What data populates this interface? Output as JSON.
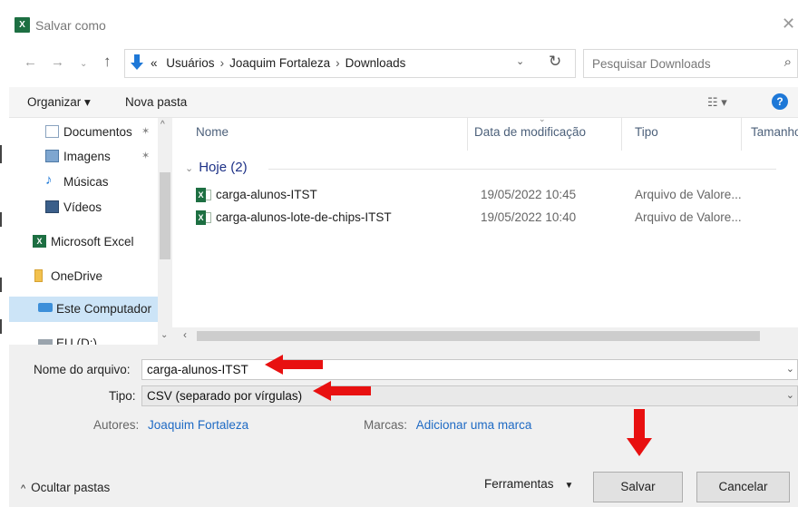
{
  "window": {
    "title": "Salvar como",
    "app_icon_text": "X"
  },
  "address": {
    "crumbs": [
      "«",
      "Usuários",
      "Joaquim Fortaleza",
      "Downloads"
    ],
    "search_placeholder": "Pesquisar Downloads"
  },
  "toolbar": {
    "organize": "Organizar ▾",
    "new_folder": "Nova pasta"
  },
  "nav": {
    "items": [
      {
        "label": "Documentos",
        "icon": "documents-icon"
      },
      {
        "label": "Imagens",
        "icon": "pictures-icon"
      },
      {
        "label": "Músicas",
        "icon": "music-icon"
      },
      {
        "label": "Vídeos",
        "icon": "videos-icon"
      },
      {
        "label": "Microsoft Excel",
        "icon": "excel-icon"
      },
      {
        "label": "OneDrive",
        "icon": "onedrive-icon"
      },
      {
        "label": "Este Computador",
        "icon": "computer-icon"
      },
      {
        "label": "EU (D:)",
        "icon": "drive-icon"
      }
    ]
  },
  "files": {
    "columns": [
      "Nome",
      "Data de modificação",
      "Tipo",
      "Tamanho"
    ],
    "group": "Hoje (2)",
    "rows": [
      {
        "name": "carga-alunos-ITST",
        "date": "19/05/2022 10:45",
        "type": "Arquivo de Valore..."
      },
      {
        "name": "carga-alunos-lote-de-chips-ITST",
        "date": "19/05/2022 10:40",
        "type": "Arquivo de Valore..."
      }
    ]
  },
  "form": {
    "filename_label": "Nome do arquivo:",
    "filename_value": "carga-alunos-ITST",
    "type_label": "Tipo:",
    "type_value": "CSV (separado por vírgulas)",
    "authors_label": "Autores:",
    "authors_value": "Joaquim Fortaleza",
    "tags_label": "Marcas:",
    "tags_value": "Adicionar uma marca"
  },
  "footer": {
    "hide_folders": "Ocultar pastas",
    "tools": "Ferramentas",
    "save": "Salvar",
    "cancel": "Cancelar"
  },
  "colors": {
    "accent": "#1e78d7",
    "excel_green": "#1d6f42",
    "annotation_red": "#e81010",
    "link_blue": "#1e6ac4"
  }
}
